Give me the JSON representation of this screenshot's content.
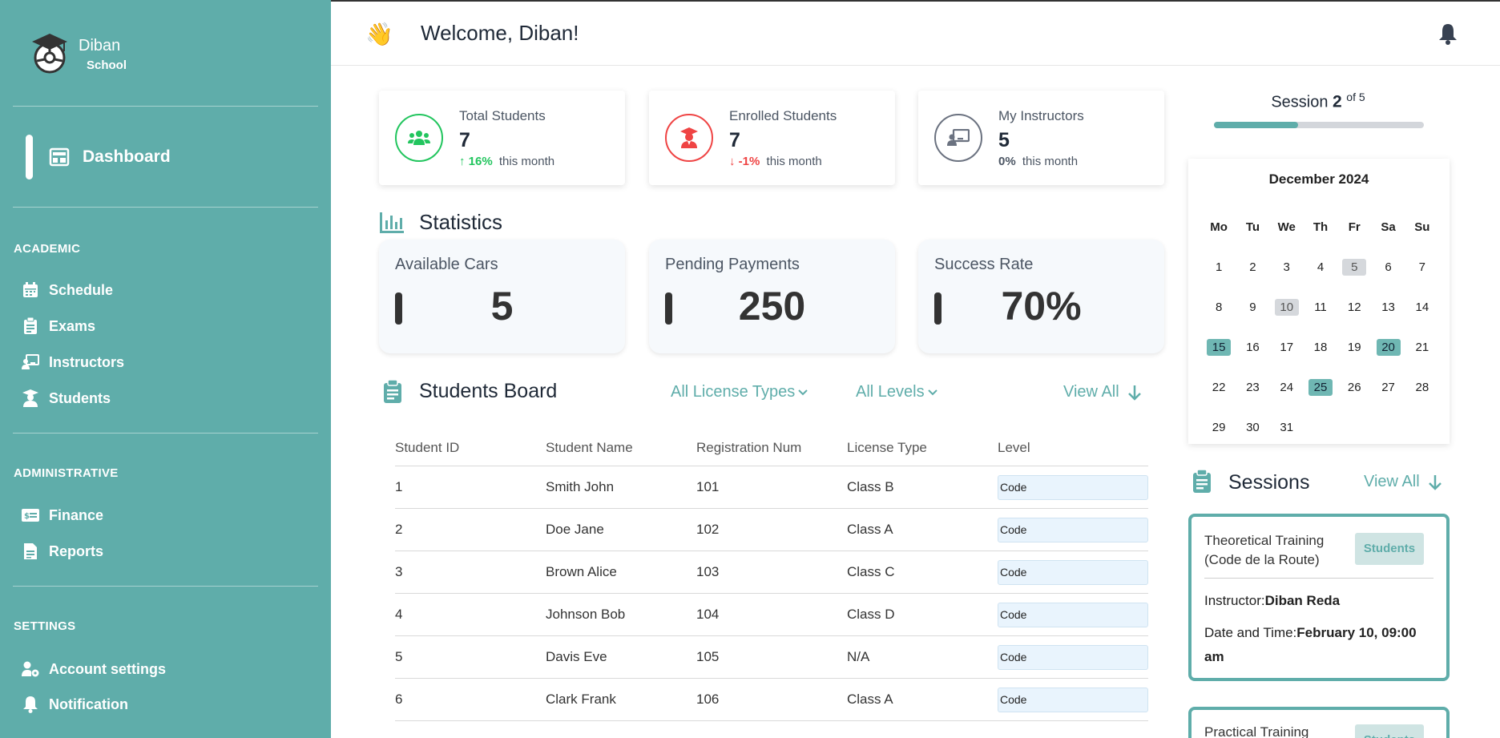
{
  "brand": {
    "name": "Diban",
    "sub": "School"
  },
  "sidebar": {
    "active": {
      "label": "Dashboard"
    },
    "sections": [
      {
        "title": "ACADEMIC",
        "items": [
          {
            "label": "Schedule",
            "icon": "calendar-icon"
          },
          {
            "label": "Exams",
            "icon": "clipboard-icon"
          },
          {
            "label": "Instructors",
            "icon": "instructor-icon"
          },
          {
            "label": "Students",
            "icon": "student-icon"
          }
        ]
      },
      {
        "title": "ADMINISTRATIVE",
        "items": [
          {
            "label": "Finance",
            "icon": "money-icon"
          },
          {
            "label": "Reports",
            "icon": "document-icon"
          }
        ]
      },
      {
        "title": "SETTINGS",
        "items": [
          {
            "label": "Account settings",
            "icon": "user-gear-icon"
          },
          {
            "label": "Notification",
            "icon": "bell-icon"
          }
        ]
      }
    ]
  },
  "header": {
    "emoji": "👋",
    "welcome": "Welcome, Diban!"
  },
  "stats": [
    {
      "label": "Total Students",
      "value": "7",
      "change": "16%",
      "change_suffix": "this month",
      "trend": "up",
      "color": "#22c55e"
    },
    {
      "label": "Enrolled Students",
      "value": "7",
      "change": "-1%",
      "change_suffix": "this month",
      "trend": "down",
      "color": "#ef4444"
    },
    {
      "label": "My Instructors",
      "value": "5",
      "change": "0%",
      "change_suffix": "this month",
      "trend": "flat",
      "color": "#6b7280"
    }
  ],
  "statistics": {
    "title": "Statistics",
    "metrics": [
      {
        "label": "Available Cars",
        "value": "5"
      },
      {
        "label": "Pending Payments",
        "value": "250"
      },
      {
        "label": "Success Rate",
        "value": "70%"
      }
    ]
  },
  "board": {
    "title": "Students Board",
    "filter_license": "All License Types",
    "filter_level": "All Levels",
    "view_all": "View All",
    "columns": [
      "Student ID",
      "Student Name",
      "Registration Num",
      "License Type",
      "Level"
    ],
    "rows": [
      {
        "id": "1",
        "name": "Smith John",
        "reg": "101",
        "license": "Class B",
        "level": "Code"
      },
      {
        "id": "2",
        "name": "Doe Jane",
        "reg": "102",
        "license": "Class A",
        "level": "Code"
      },
      {
        "id": "3",
        "name": "Brown Alice",
        "reg": "103",
        "license": "Class C",
        "level": "Code"
      },
      {
        "id": "4",
        "name": "Johnson Bob",
        "reg": "104",
        "license": "Class D",
        "level": "Code"
      },
      {
        "id": "5",
        "name": "Davis Eve",
        "reg": "105",
        "license": "N/A",
        "level": "Code"
      },
      {
        "id": "6",
        "name": "Clark Frank",
        "reg": "106",
        "license": "Class A",
        "level": "Code"
      }
    ]
  },
  "session_progress": {
    "label": "Session",
    "current": "2",
    "of": "of 5",
    "fraction": 0.4
  },
  "calendar": {
    "title": "December 2024",
    "weekdays": [
      "Mo",
      "Tu",
      "We",
      "Th",
      "Fr",
      "Sa",
      "Su"
    ],
    "weeks": [
      [
        "1",
        "2",
        "3",
        "4",
        "5",
        "6",
        "7"
      ],
      [
        "8",
        "9",
        "10",
        "11",
        "12",
        "13",
        "14"
      ],
      [
        "15",
        "16",
        "17",
        "18",
        "19",
        "20",
        "21"
      ],
      [
        "22",
        "23",
        "24",
        "25",
        "26",
        "27",
        "28"
      ],
      [
        "29",
        "30",
        "31",
        "",
        "",
        "",
        ""
      ]
    ],
    "highlight_gray": [
      "5",
      "10"
    ],
    "highlight_teal": [
      "15",
      "20",
      "25"
    ]
  },
  "sessions": {
    "title": "Sessions",
    "view_all": "View All",
    "items": [
      {
        "name": "Theoretical Training (Code de la Route)",
        "badge": "Students",
        "instructor_label": "Instructor:",
        "instructor": "Diban Reda",
        "date_label": "Date and Time:",
        "date": "February 10, 09:00 am"
      },
      {
        "name": "Practical Training",
        "badge": "Students"
      }
    ]
  }
}
